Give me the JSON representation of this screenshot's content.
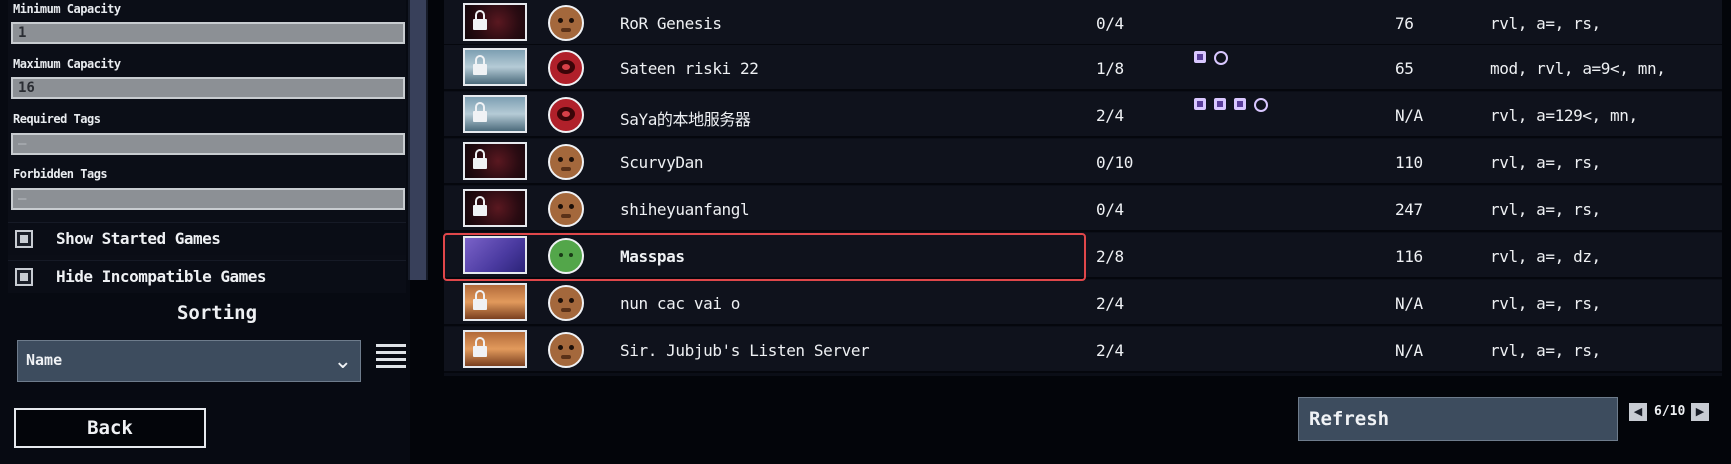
{
  "filters": {
    "min_capacity_label": "Minimum Capacity",
    "min_capacity_value": "1",
    "max_capacity_label": "Maximum Capacity",
    "max_capacity_value": "16",
    "required_tags_label": "Required Tags",
    "required_tags_placeholder": "—",
    "forbidden_tags_label": "Forbidden Tags",
    "forbidden_tags_placeholder": "—",
    "show_started_label": "Show Started Games",
    "hide_incompatible_label": "Hide Incompatible Games"
  },
  "sorting": {
    "title": "Sorting",
    "selected": "Name"
  },
  "back_label": "Back",
  "servers": [
    {
      "name": "RoR Genesis",
      "players": "0/4",
      "ping": "76",
      "tags": "rvl, a=, rs,",
      "locked": true,
      "thumb": "t-dark",
      "avatar": "lemurian",
      "mods": 0
    },
    {
      "name": "Sateen riski 22",
      "players": "1/8",
      "ping": "65",
      "tags": "mod, rvl, a=9<, mn,",
      "locked": true,
      "thumb": "t-snow",
      "avatar": "imp",
      "mods": 2
    },
    {
      "name": "SaYa的本地服务器",
      "players": "2/4",
      "ping": "N/A",
      "tags": "rvl, a=129<, mn,",
      "locked": true,
      "thumb": "t-snow",
      "avatar": "imp",
      "mods": 4
    },
    {
      "name": "ScurvyDan",
      "players": "0/10",
      "ping": "110",
      "tags": "rvl, a=, rs,",
      "locked": true,
      "thumb": "t-dark",
      "avatar": "lemurian",
      "mods": 0
    },
    {
      "name": "shiheyuanfangl",
      "players": "0/4",
      "ping": "247",
      "tags": "rvl, a=, rs,",
      "locked": true,
      "thumb": "t-dark",
      "avatar": "lemurian",
      "mods": 0
    },
    {
      "name": "Masspas",
      "players": "2/8",
      "ping": "116",
      "tags": "rvl, a=, dz,",
      "locked": false,
      "thumb": "t-purple",
      "avatar": "green",
      "mods": 0,
      "highlighted": true
    },
    {
      "name": "nun cac vai o",
      "players": "2/4",
      "ping": "N/A",
      "tags": "rvl, a=, rs,",
      "locked": true,
      "thumb": "t-orange",
      "avatar": "lemurian",
      "mods": 0
    },
    {
      "name": "Sir. Jubjub's Listen Server",
      "players": "2/4",
      "ping": "N/A",
      "tags": "rvl, a=, rs,",
      "locked": true,
      "thumb": "t-orange",
      "avatar": "lemurian",
      "mods": 0
    }
  ],
  "refresh_label": "Refresh",
  "pagination": {
    "indicator": "6/10",
    "prev_icon": "◀",
    "next_icon": "▶"
  },
  "colors": {
    "highlight": "#e0474a",
    "button_bg": "#3d4c5e",
    "input_bg": "#8c9095"
  }
}
